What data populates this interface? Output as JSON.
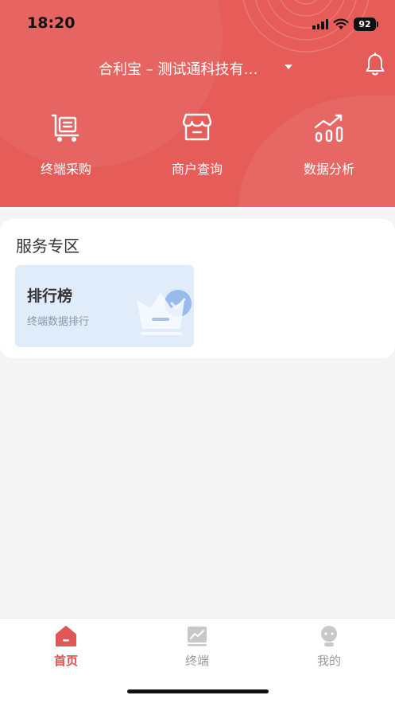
{
  "status_bar": {
    "time": "18:20",
    "battery": "92"
  },
  "top_bar": {
    "company": "合利宝 – 测试通科技有…"
  },
  "quick_actions": [
    {
      "label": "终端采购",
      "icon": "cart-icon"
    },
    {
      "label": "商户查询",
      "icon": "store-icon"
    },
    {
      "label": "数据分析",
      "icon": "chart-icon"
    }
  ],
  "service": {
    "title": "服务专区",
    "ranking": {
      "title": "排行榜",
      "subtitle": "终端数据排行",
      "icon": "crown-icon"
    }
  },
  "tabs": [
    {
      "label": "首页",
      "icon": "home-icon",
      "active": true
    },
    {
      "label": "终端",
      "icon": "terminal-icon",
      "active": false
    },
    {
      "label": "我的",
      "icon": "user-icon",
      "active": false
    }
  ],
  "colors": {
    "header": "#e55c59",
    "active_tab": "#d9514d",
    "inactive_tab": "#999999",
    "page_bg": "#f5f5f6"
  }
}
